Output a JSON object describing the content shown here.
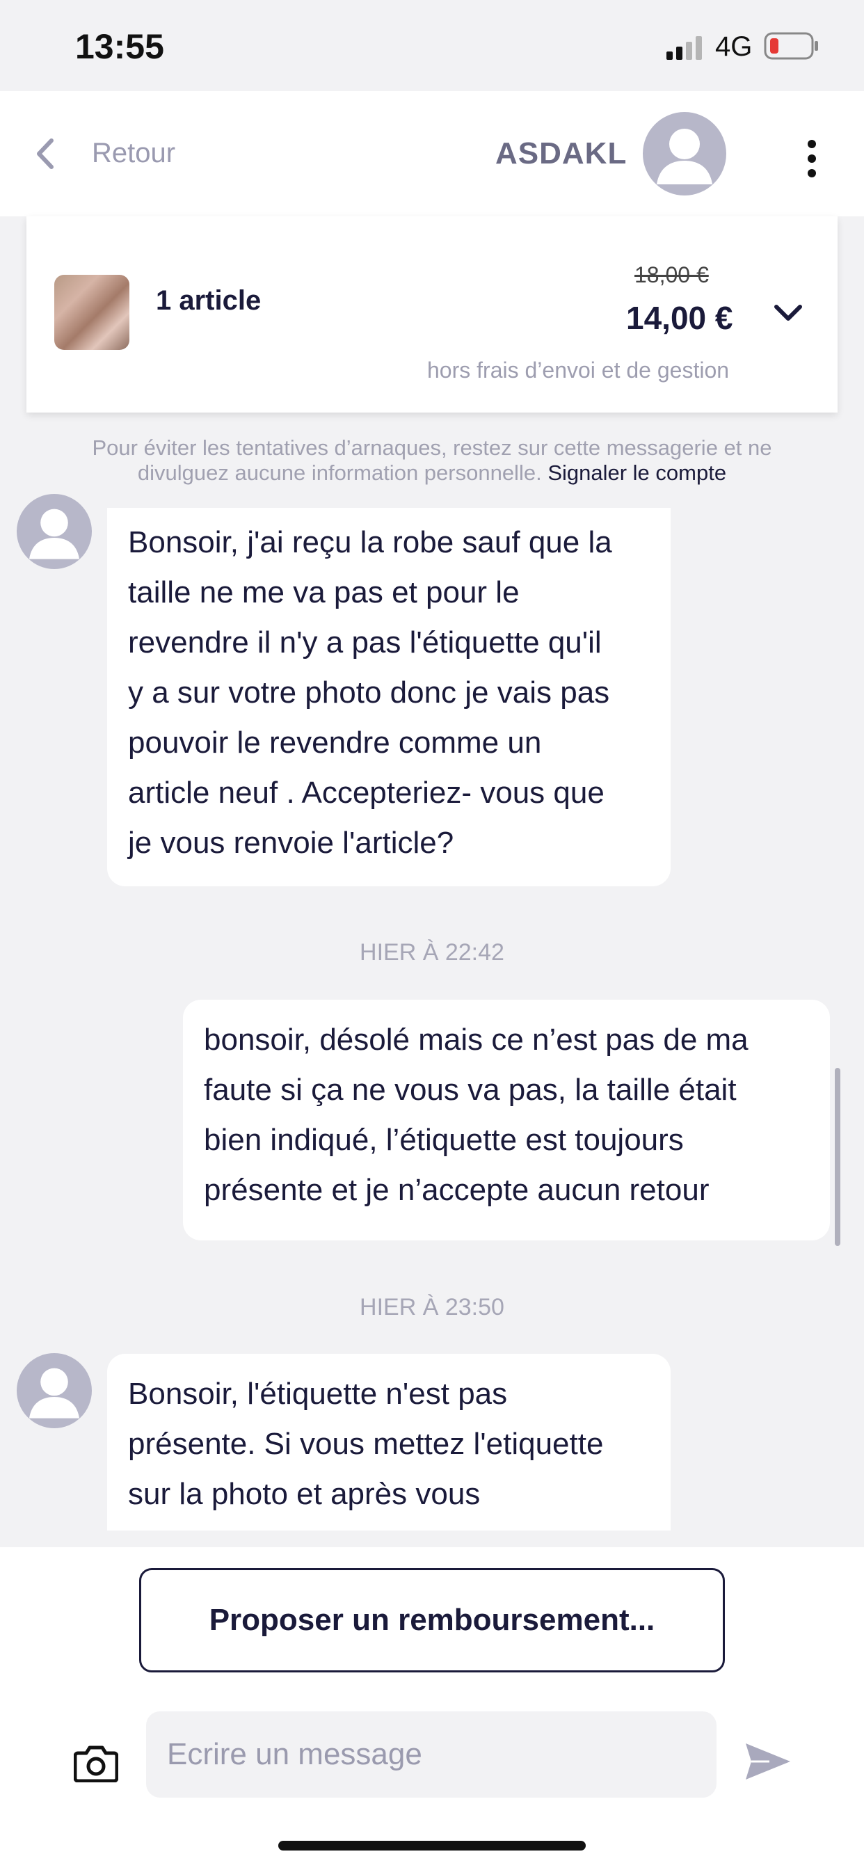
{
  "status_bar": {
    "time": "13:55",
    "network": "4G"
  },
  "header": {
    "back_label": "Retour",
    "user_name": "ASDAKL"
  },
  "item": {
    "count_label": "1 article",
    "old_price": "18,00 €",
    "price": "14,00 €",
    "shipping_note": "hors frais d’envoi et de gestion"
  },
  "warning": {
    "text": "Pour éviter les tentatives d’arnaques, restez sur cette messagerie et ne divulguez aucune information personnelle.",
    "report_link": "Signaler le compte"
  },
  "messages": [
    {
      "from": "other",
      "lines": [
        "Bonsoir, j'ai reçu la robe sauf que la",
        "taille ne me va pas et pour le",
        "revendre il n'y a pas l'étiquette qu'il",
        "y a sur votre photo donc je vais pas",
        "pouvoir le revendre comme un",
        "article neuf . Accepteriez- vous que",
        "je vous renvoie l'article?"
      ]
    },
    {
      "timestamp": "HIER À 22:42"
    },
    {
      "from": "me",
      "lines": [
        "bonsoir, désolé mais ce n’est pas de ma",
        "faute si ça ne vous va pas, la taille était",
        "bien indiqué, l’étiquette est toujours",
        "présente et je n’accepte aucun retour"
      ]
    },
    {
      "timestamp": "HIER À 23:50"
    },
    {
      "from": "other",
      "lines": [
        "Bonsoir, l'étiquette n'est pas",
        "présente. Si vous mettez l'etiquette",
        "sur la photo et après vous"
      ]
    }
  ],
  "actions": {
    "refund_button": "Proposer un remboursement..."
  },
  "composer": {
    "placeholder": "Ecrire un message"
  },
  "icons": [
    "back-chevron-icon",
    "avatar-icon",
    "more-vertical-icon",
    "chevron-down-icon",
    "camera-icon",
    "send-icon",
    "signal-icon",
    "battery-icon"
  ],
  "colors": {
    "text": "#1a1a3a",
    "muted": "#9a9ab0",
    "background": "#f2f2f4",
    "battery_low": "#e53935"
  }
}
